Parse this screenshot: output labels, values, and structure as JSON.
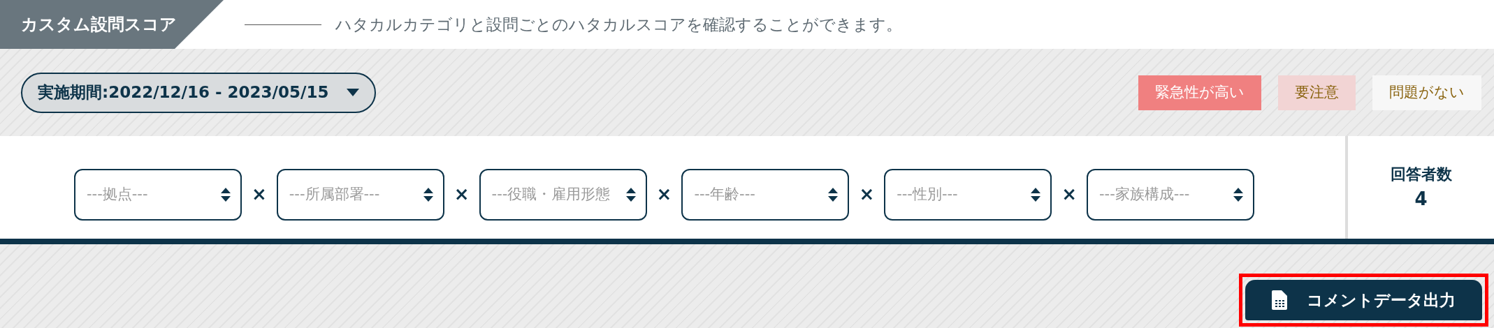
{
  "header": {
    "title": "カスタム設問スコア",
    "description": "ハタカルカテゴリと設問ごとのハタカルスコアを確認することができます。"
  },
  "period": {
    "label": "実施期間:2022/12/16 - 2023/05/15"
  },
  "legend": [
    {
      "label": "緊急性が高い",
      "kind": "urgent",
      "color": "#f08080"
    },
    {
      "label": "要注意",
      "kind": "caution",
      "color": "#f2d4d4"
    },
    {
      "label": "問題がない",
      "kind": "ok",
      "color": "#f7f7f7"
    }
  ],
  "filters": [
    {
      "placeholder": "---拠点---"
    },
    {
      "placeholder": "---所属部署---"
    },
    {
      "placeholder": "---役職・雇用形態"
    },
    {
      "placeholder": "---年齢---"
    },
    {
      "placeholder": "---性別---"
    },
    {
      "placeholder": "---家族構成---"
    }
  ],
  "separators": [
    "×",
    "×",
    "×",
    "×",
    "×"
  ],
  "respondents": {
    "label": "回答者数",
    "count": "4"
  },
  "export_button": {
    "label": "コメントデータ出力",
    "highlighted": true
  }
}
